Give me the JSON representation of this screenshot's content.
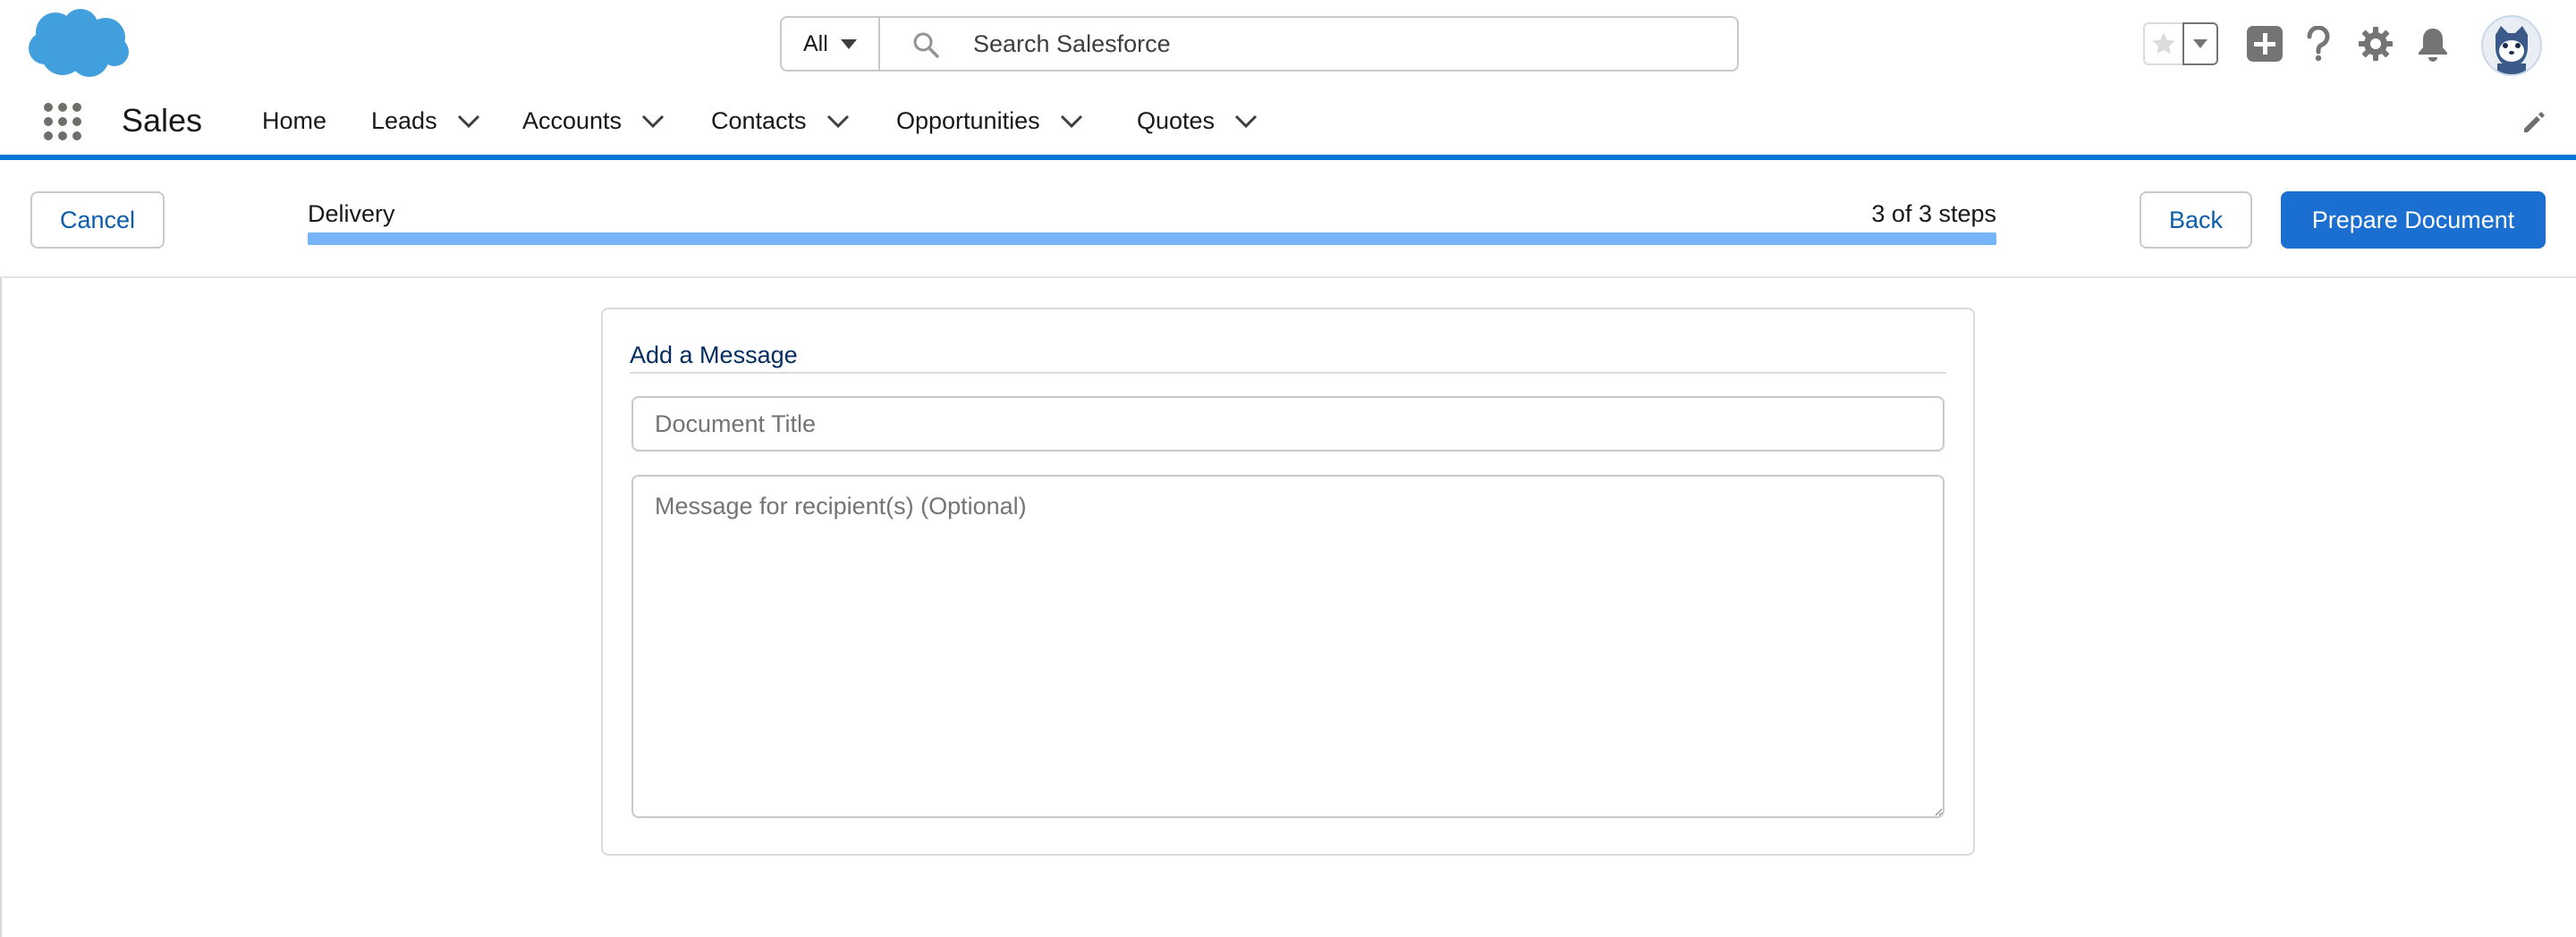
{
  "header": {
    "search": {
      "scope": "All",
      "placeholder": "Search Salesforce"
    },
    "icons": [
      "salesforce-cloud-logo",
      "favorites-star-icon",
      "chevron-down-icon",
      "add-icon",
      "help-icon",
      "gear-icon",
      "bell-icon",
      "avatar"
    ]
  },
  "nav": {
    "app_name": "Sales",
    "items": [
      {
        "label": "Home"
      },
      {
        "label": "Leads"
      },
      {
        "label": "Accounts"
      },
      {
        "label": "Contacts"
      },
      {
        "label": "Opportunities"
      },
      {
        "label": "Quotes"
      }
    ]
  },
  "flow": {
    "cancel_label": "Cancel",
    "step_name": "Delivery",
    "step_count": "3 of 3 steps",
    "progress_fraction": 1.0,
    "back_label": "Back",
    "prepare_label": "Prepare Document"
  },
  "message_section": {
    "title": "Add a Message",
    "document_title_placeholder": "Document Title",
    "document_title_value": "",
    "message_placeholder": "Message for recipient(s) (Optional)",
    "message_value": ""
  },
  "colors": {
    "brand": "#0176d3",
    "brand_button": "#1b6fd0",
    "progress_fill": "#76b3f7",
    "logo": "#419fdd"
  }
}
